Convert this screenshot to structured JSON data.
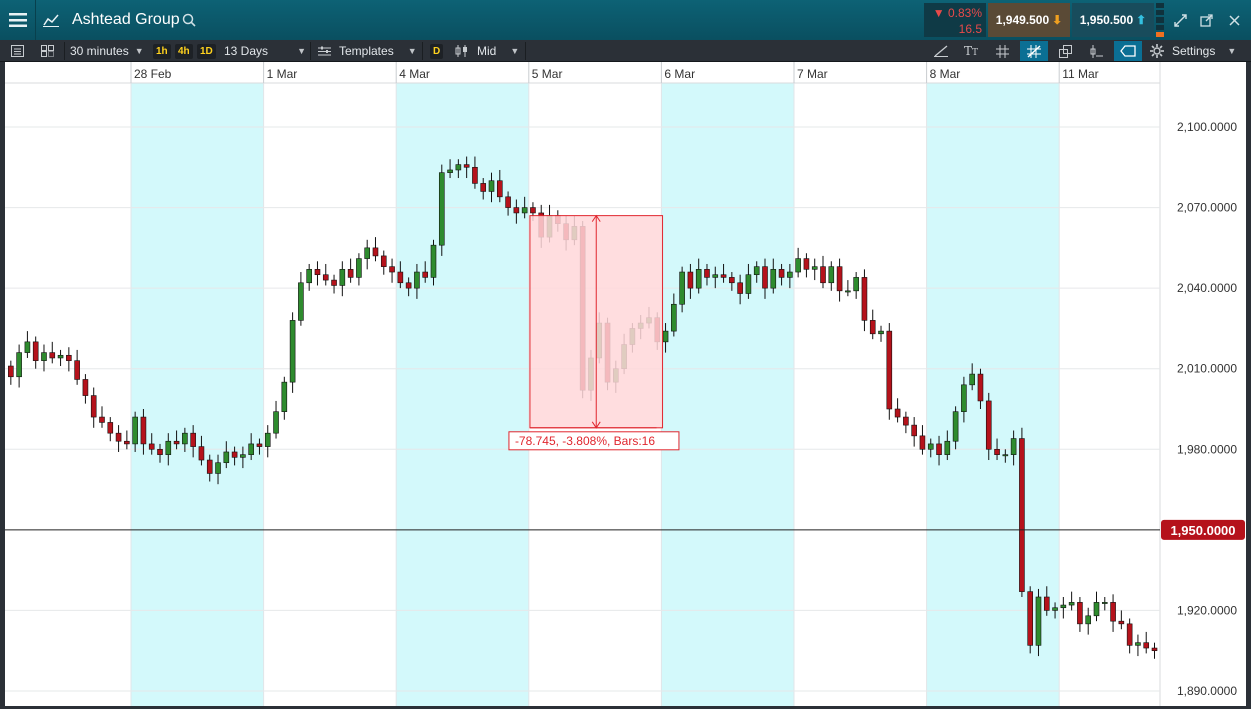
{
  "header": {
    "title": "Ashtead Group",
    "change_pct": "▼ 0.83%",
    "change_abs": "16.5",
    "sell_price": "1,949.500",
    "buy_price": "1,950.500",
    "depth_levels": 5,
    "depth_active": [
      1
    ]
  },
  "toolbar": {
    "interval": "30 minutes",
    "quick_1h": "1h",
    "quick_4h": "4h",
    "quick_1d": "1D",
    "range": "13 Days",
    "templates": "Templates",
    "d_badge": "D",
    "price_type": "Mid",
    "settings": "Settings"
  },
  "colors": {
    "up": "#2e8b2e",
    "down": "#b5121b",
    "shade": "#d3f9fb",
    "price_line_badge": "#b5121b",
    "measure_fill": "#ffd7d9",
    "measure_stroke": "#e0262e"
  },
  "chart_data": {
    "type": "candlestick",
    "dates": [
      "28 Feb",
      "1 Mar",
      "4 Mar",
      "5 Mar",
      "6 Mar",
      "7 Mar",
      "8 Mar",
      "11 Mar"
    ],
    "shaded_dates": [
      "28 Feb",
      "4 Mar",
      "6 Mar",
      "8 Mar"
    ],
    "y_ticks": [
      "2,100.0000",
      "2,070.0000",
      "2,040.0000",
      "2,010.0000",
      "1,980.0000",
      "1,920.0000",
      "1,890.0000"
    ],
    "y_tick_values": [
      2100,
      2070,
      2040,
      2010,
      1980,
      1920,
      1890
    ],
    "ylim": [
      1886,
      2117
    ],
    "current_price": 1950,
    "current_price_label": "1,950.0000",
    "bars_per_day": 16,
    "closes": [
      2007,
      2016,
      2020,
      2013,
      2016,
      2014,
      2015,
      2013,
      2006,
      2000,
      1992,
      1990,
      1986,
      1983,
      1982,
      1992,
      1982,
      1980,
      1978,
      1983,
      1982,
      1986,
      1981,
      1976,
      1971,
      1975,
      1979,
      1977,
      1978,
      1982,
      1981,
      1986,
      1994,
      2005,
      2028,
      2042,
      2047,
      2045,
      2043,
      2041,
      2047,
      2044,
      2051,
      2055,
      2052,
      2048,
      2046,
      2042,
      2040,
      2046,
      2044,
      2056,
      2083,
      2084,
      2086,
      2085,
      2079,
      2076,
      2080,
      2074,
      2070,
      2068,
      2070,
      2068,
      2059,
      2067,
      2064,
      2058,
      2063,
      2002,
      2014,
      2027,
      2005,
      2010,
      2019,
      2025,
      2027,
      2029,
      2020,
      2024,
      2034,
      2046,
      2040,
      2047,
      2044,
      2045,
      2044,
      2042,
      2038,
      2045,
      2048,
      2040,
      2047,
      2044,
      2046,
      2051,
      2047,
      2048,
      2042,
      2048,
      2039,
      2039,
      2044,
      2028,
      2023,
      2024,
      1995,
      1992,
      1989,
      1985,
      1980,
      1982,
      1978,
      1983,
      1994,
      2004,
      2008,
      1998,
      1980,
      1978,
      1978,
      1984,
      1927,
      1907,
      1925,
      1920,
      1921,
      1922,
      1923,
      1915,
      1918,
      1923,
      1923,
      1916,
      1915,
      1907,
      1908,
      1906,
      1905,
      1902,
      1903,
      1920,
      1914,
      1924,
      1928,
      1920,
      1915,
      1913,
      1912,
      1913,
      1910,
      1913,
      1916
    ]
  },
  "measure": {
    "label": "-78.745, -3.808%, Bars:16",
    "start_value": 2067,
    "end_value": 1988,
    "start_bar": 63,
    "bars": 16
  }
}
